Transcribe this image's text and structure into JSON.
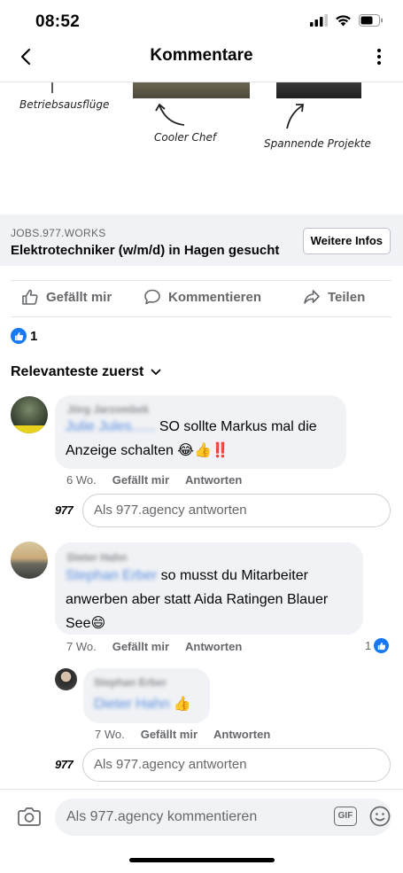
{
  "status": {
    "time": "08:52"
  },
  "header": {
    "title": "Kommentare"
  },
  "ad": {
    "captions": [
      "Betriebsausflüge",
      "Cooler Chef",
      "Spannende Projekte"
    ],
    "domain": "JOBS.977.WORKS",
    "title": "Elektrotechniker (w/m/d)  in Hagen gesucht",
    "cta_label": "Weitere Infos"
  },
  "actions": {
    "like": "Gefällt mir",
    "comment": "Kommentieren",
    "share": "Teilen"
  },
  "reactions": {
    "count": "1"
  },
  "sort": {
    "label": "Relevanteste zuerst"
  },
  "comments": [
    {
      "author": "Jörg Jarzombek",
      "mention": "Julie Jules......",
      "text_line1": " SO sollte Markus mal die",
      "text_line2": "Anzeige schalten 😂👍‼️",
      "time": "6 Wo.",
      "like": "Gefällt mir",
      "reply": "Antworten",
      "reply_placeholder": "Als 977.agency antworten"
    },
    {
      "author": "Dieter Hahn",
      "mention": "Stephan Erber",
      "text_line1": " so musst du Mitarbeiter",
      "text_line2": "anwerben aber statt Aida  Ratingen Blauer",
      "text_line3": "See😄",
      "time": "7 Wo.",
      "like": "Gefällt mir",
      "reply": "Antworten",
      "reaction_count": "1",
      "replies": [
        {
          "author": "Stephan Erber",
          "mention": "Dieter Hahn",
          "text": " 👍",
          "time": "7 Wo.",
          "like": "Gefällt mir",
          "reply": "Antworten"
        }
      ],
      "reply_placeholder": "Als 977.agency antworten"
    }
  ],
  "brand": {
    "logo": "977"
  },
  "composer": {
    "placeholder": "Als 977.agency kommentieren",
    "gif": "GIF"
  }
}
